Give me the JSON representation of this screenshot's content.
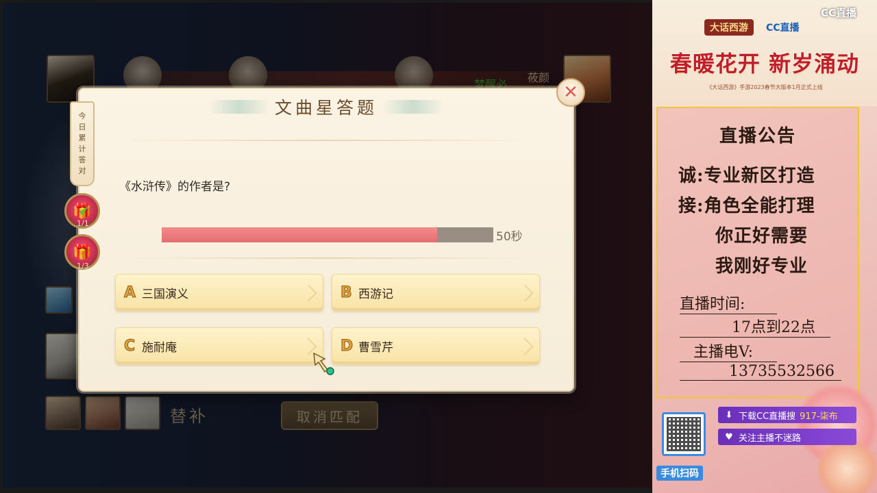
{
  "game": {
    "team_name_green": "梦醒必",
    "team_name_gold": "莜颜",
    "substitute_label": "替补",
    "cancel_match_label": "取消匹配"
  },
  "quiz": {
    "title": "文曲星答题",
    "side_tab_chars": [
      "今",
      "日",
      "累",
      "计",
      "答",
      "对"
    ],
    "reward_counts": [
      "1/1",
      "1/3"
    ],
    "question": "《水浒传》的作者是?",
    "timer_remaining_fraction": 0.83,
    "timer_label": "50秒",
    "options": [
      {
        "letter": "A",
        "text": "三国演义"
      },
      {
        "letter": "B",
        "text": "西游记"
      },
      {
        "letter": "C",
        "text": "施耐庵"
      },
      {
        "letter": "D",
        "text": "曹雪芹"
      }
    ]
  },
  "panel": {
    "brand_cc": "CC直播",
    "brand_game": "大话西游",
    "brand_cc2": "CC直播",
    "banner_title": "春暖花开 新岁涌动",
    "banner_sub": "《大话西游》手游2023春节大版本1月正式上线",
    "announcement": {
      "title": "直播公告",
      "line1": "诚:专业新区打造",
      "line2": "接:角色全能打理",
      "line3": "你正好需要",
      "line4": "我刚好专业",
      "time_label": "直播时间:",
      "time_value": "17点到22点",
      "phone_label": "主播电V:",
      "phone_value": "13735532566"
    },
    "download_text": "下载CC直播搜",
    "download_highlight": "917-柒布",
    "follow_text": "关注主播不迷路",
    "scan_label": "手机扫码"
  },
  "colors": {
    "timer_fill": "#e46e72",
    "timer_track": "#9a8e84",
    "accent_red": "#c01e2a",
    "announce_border": "#f2c63a",
    "pill_purple": "#6a2fb8"
  },
  "icons": [
    "close-icon",
    "gift-icon",
    "check-icon",
    "cursor-icon",
    "download-icon",
    "heart-icon",
    "qr-code-icon"
  ]
}
